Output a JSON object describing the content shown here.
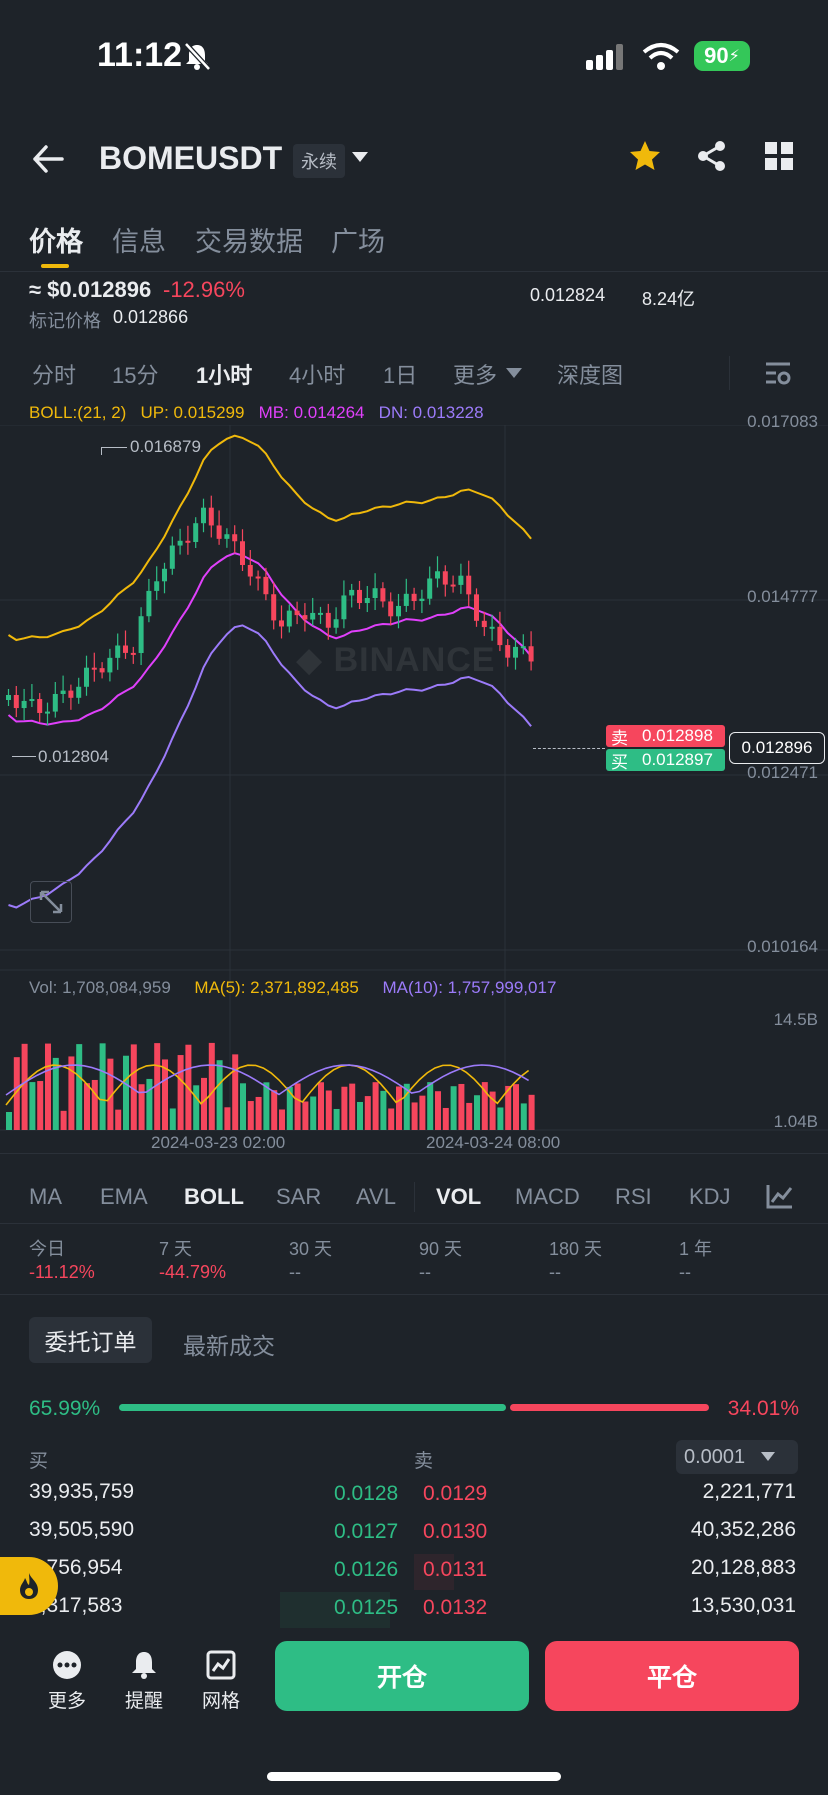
{
  "status": {
    "time": "11:12",
    "battery": "90"
  },
  "header": {
    "symbol": "BOMEUSDT",
    "contract_tag": "永续"
  },
  "tabs": [
    "价格",
    "信息",
    "交易数据",
    "广场"
  ],
  "price": {
    "last": "≈ $0.012896",
    "change": "-12.96%",
    "mark_label": "标记价格",
    "mark_value": "0.012866",
    "stat1": "0.012824",
    "stat2": "8.24亿"
  },
  "timeframes": [
    "分时",
    "15分",
    "1小时",
    "4小时",
    "1日",
    "更多",
    "深度图"
  ],
  "boll": {
    "label": "BOLL:(21, 2)",
    "up": "UP: 0.015299",
    "mb": "MB: 0.014264",
    "dn": "DN: 0.013228"
  },
  "axis_labels": [
    "0.017083",
    "0.014777",
    "0.012471",
    "0.010164"
  ],
  "chart_annotations": {
    "high": "0.016879",
    "low": "0.012804",
    "sell_label": "卖",
    "sell_price": "0.012898",
    "buy_label": "买",
    "buy_price": "0.012897",
    "current": "0.012896"
  },
  "volume": {
    "vol": "Vol: 1,708,084,959",
    "ma5": "MA(5): 2,371,892,485",
    "ma10": "MA(10): 1,757,999,017",
    "axis_top": "14.5B",
    "axis_bottom": "1.04B"
  },
  "dates": [
    "2024-03-23 02:00",
    "2024-03-24 08:00"
  ],
  "indicators": [
    "MA",
    "EMA",
    "BOLL",
    "SAR",
    "AVL",
    "VOL",
    "MACD",
    "RSI",
    "KDJ"
  ],
  "performance": [
    {
      "label": "今日",
      "value": "-11.12%"
    },
    {
      "label": "7 天",
      "value": "-44.79%"
    },
    {
      "label": "30 天",
      "value": "--"
    },
    {
      "label": "90 天",
      "value": "--"
    },
    {
      "label": "180 天",
      "value": "--"
    },
    {
      "label": "1 年",
      "value": "--"
    }
  ],
  "orderbook": {
    "tabs": [
      "委托订单",
      "最新成交"
    ],
    "buy_ratio": "65.99%",
    "sell_ratio": "34.01%",
    "buy_fraction": 0.6599,
    "buy_header": "买",
    "sell_header": "卖",
    "precision": "0.0001",
    "rows": [
      {
        "buy_qty": "39,935,759",
        "buy_price": "0.0128",
        "sell_price": "0.0129",
        "sell_qty": "2,221,771"
      },
      {
        "buy_qty": "39,505,590",
        "buy_price": "0.0127",
        "sell_price": "0.0130",
        "sell_qty": "40,352,286"
      },
      {
        "buy_qty": "?,756,954",
        "buy_price": "0.0126",
        "sell_price": "0.0131",
        "sell_qty": "20,128,883"
      },
      {
        "buy_qty": "?,317,583",
        "buy_price": "0.0125",
        "sell_price": "0.0132",
        "sell_qty": "13,530,031"
      }
    ]
  },
  "bottom": {
    "more": "更多",
    "alert": "提醒",
    "grid": "网格",
    "open": "开仓",
    "close": "平仓"
  },
  "colors": {
    "green": "#2ebd85",
    "red": "#f6465d",
    "yellow": "#f0b90b",
    "magenta": "#e040fb",
    "purple": "#9c7bfa"
  }
}
